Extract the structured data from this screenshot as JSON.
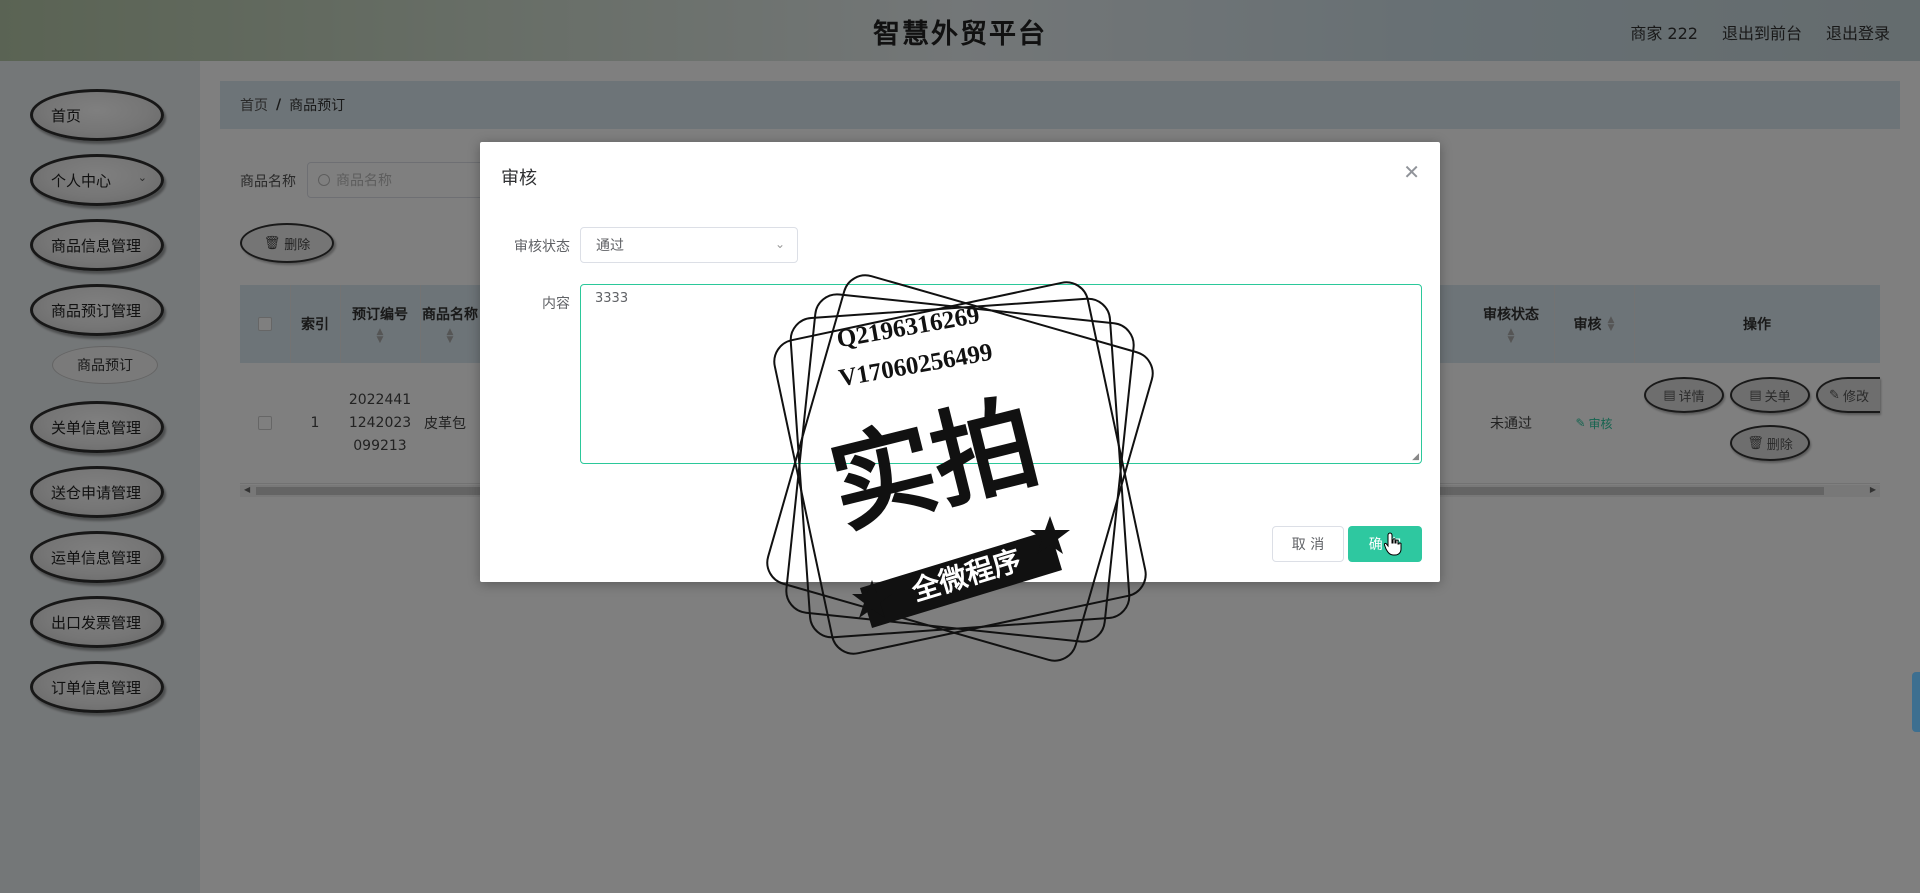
{
  "header": {
    "title": "智慧外贸平台",
    "user": "商家 222",
    "to_front": "退出到前台",
    "logout": "退出登录"
  },
  "sidebar": {
    "items": [
      {
        "label": "首页"
      },
      {
        "label": "个人中心",
        "has_chevron": true
      },
      {
        "label": "商品信息管理"
      },
      {
        "label": "商品预订管理"
      },
      {
        "label": "商品预订",
        "sub": true
      },
      {
        "label": "关单信息管理"
      },
      {
        "label": "送仓申请管理"
      },
      {
        "label": "运单信息管理"
      },
      {
        "label": "出口发票管理"
      },
      {
        "label": "订单信息管理"
      }
    ]
  },
  "breadcrumb": {
    "home": "首页",
    "sep": "/",
    "current": "商品预订"
  },
  "search": {
    "label": "商品名称",
    "placeholder": "商品名称"
  },
  "toolbar": {
    "delete_label": "删除"
  },
  "table": {
    "headers": {
      "index": "索引",
      "order_no": "预订编号",
      "product_name": "商品名称",
      "review_status": "审核状态",
      "review": "审核",
      "actions": "操作"
    },
    "row": {
      "index": "1",
      "order_no_lines": [
        "2022441",
        "1242023",
        "099213"
      ],
      "product_name": "皮革包",
      "review_status": "未通过",
      "review_link": "审核",
      "actions": {
        "detail": "详情",
        "customs": "关单",
        "edit": "修改",
        "delete": "删除"
      }
    }
  },
  "modal": {
    "title": "审核",
    "status_label": "审核状态",
    "status_value": "通过",
    "content_label": "内容",
    "content_value": "3333",
    "cancel": "取 消",
    "confirm": "确 定"
  },
  "watermark": {
    "line1": "Q2196316269",
    "line2": "V17060256499",
    "big": "实拍",
    "banner": "全微程序"
  },
  "colors": {
    "accent": "#2ec8a0",
    "table_header": "#dbe9f0",
    "overlay": "rgba(0,0,0,0.5)"
  }
}
